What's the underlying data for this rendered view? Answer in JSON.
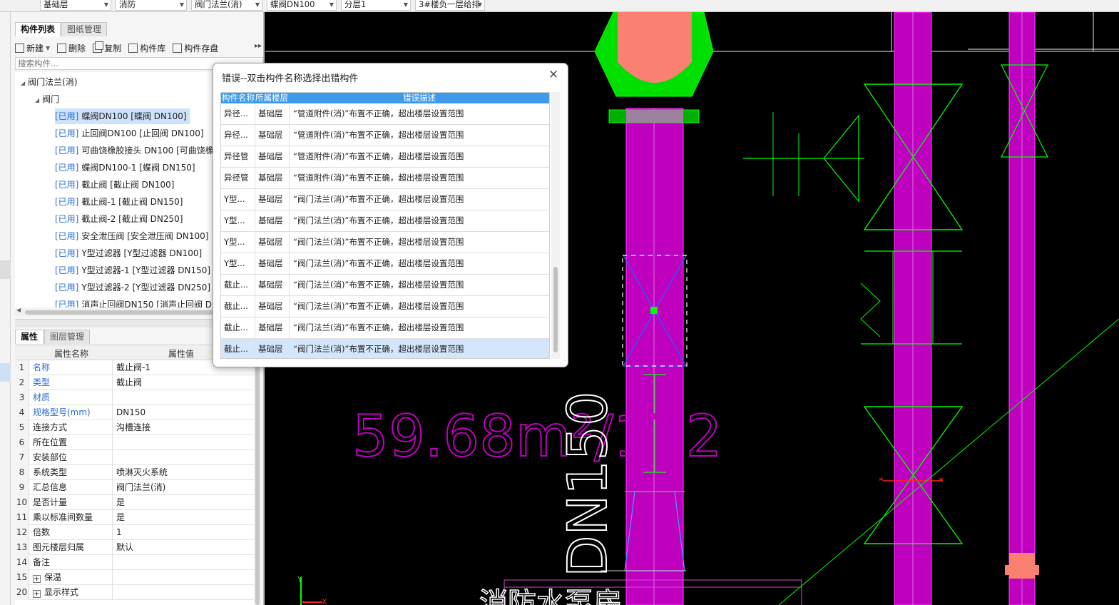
{
  "top_dropdowns": [
    {
      "value": "基础层"
    },
    {
      "value": "消防"
    },
    {
      "value": "阀门法兰(消)"
    },
    {
      "value": "蝶阀DN100"
    },
    {
      "value": "分层1"
    },
    {
      "value": "3#楼负一层给排"
    }
  ],
  "component_panel": {
    "tabs": [
      "构件列表",
      "图纸管理"
    ],
    "toolbar": {
      "new": "新建",
      "delete": "删除",
      "copy": "复制",
      "library": "构件库",
      "save": "构件存盘"
    },
    "search_placeholder": "搜索构件...",
    "tree_root": "阀门法兰(消)",
    "tree_group": "阀门",
    "used_tag": "[已用]",
    "items": [
      "蝶阀DN100 [蝶阀 DN100]",
      "止回阀DN100 [止回阀 DN100]",
      "可曲饶橡胶接头 DN100 [可曲饶橡",
      "蝶阀DN100-1 [蝶阀 DN150]",
      "截止阀 [截止阀 DN100]",
      "截止阀-1 [截止阀 DN150]",
      "截止阀-2 [截止阀 DN250]",
      "安全泄压阀 [安全泄压阀 DN100]",
      "Y型过滤器 [Y型过滤器 DN100]",
      "Y型过滤器-1 [Y型过滤器 DN150]",
      "Y型过滤器-2 [Y型过滤器 DN250]",
      "消声止回阀DN150 [消声止回阀 D"
    ]
  },
  "property_panel": {
    "tabs": [
      "属性",
      "图层管理"
    ],
    "col_name": "属性名称",
    "col_value": "属性值",
    "rows": [
      {
        "n": "1",
        "k": "名称",
        "v": "截止阀-1",
        "blue": true
      },
      {
        "n": "2",
        "k": "类型",
        "v": "截止阀",
        "blue": true
      },
      {
        "n": "3",
        "k": "材质",
        "v": "",
        "blue": true
      },
      {
        "n": "4",
        "k": "规格型号(mm)",
        "v": "DN150",
        "blue": true
      },
      {
        "n": "5",
        "k": "连接方式",
        "v": "沟槽连接",
        "blue": false
      },
      {
        "n": "6",
        "k": "所在位置",
        "v": "",
        "blue": false
      },
      {
        "n": "7",
        "k": "安装部位",
        "v": "",
        "blue": false
      },
      {
        "n": "8",
        "k": "系统类型",
        "v": "喷淋灭火系统",
        "blue": false
      },
      {
        "n": "9",
        "k": "汇总信息",
        "v": "阀门法兰(消)",
        "blue": false
      },
      {
        "n": "10",
        "k": "是否计量",
        "v": "是",
        "blue": false
      },
      {
        "n": "11",
        "k": "乘以标准间数量",
        "v": "是",
        "blue": false
      },
      {
        "n": "12",
        "k": "倍数",
        "v": "1",
        "blue": false
      },
      {
        "n": "13",
        "k": "图元楼层归属",
        "v": "默认",
        "blue": false
      },
      {
        "n": "14",
        "k": "备注",
        "v": "",
        "blue": false
      },
      {
        "n": "15",
        "k": "保温",
        "v": "",
        "blue": false,
        "expand": true
      },
      {
        "n": "20",
        "k": "显示样式",
        "v": "",
        "blue": false,
        "expand": true
      }
    ]
  },
  "dialog": {
    "title": "错误--双击构件名称选择出错构件",
    "columns": [
      "构件名称",
      "所属楼层",
      "错误描述"
    ],
    "rows": [
      {
        "name": "异径...",
        "floor": "基础层",
        "desc": "“管道附件(消)”布置不正确，超出楼层设置范围"
      },
      {
        "name": "异径...",
        "floor": "基础层",
        "desc": "“管道附件(消)”布置不正确，超出楼层设置范围"
      },
      {
        "name": "异径管",
        "floor": "基础层",
        "desc": "“管道附件(消)”布置不正确，超出楼层设置范围"
      },
      {
        "name": "异径管",
        "floor": "基础层",
        "desc": "“管道附件(消)”布置不正确，超出楼层设置范围"
      },
      {
        "name": "Y型...",
        "floor": "基础层",
        "desc": "“阀门法兰(消)”布置不正确，超出楼层设置范围"
      },
      {
        "name": "Y型...",
        "floor": "基础层",
        "desc": "“阀门法兰(消)”布置不正确，超出楼层设置范围"
      },
      {
        "name": "Y型...",
        "floor": "基础层",
        "desc": "“阀门法兰(消)”布置不正确，超出楼层设置范围"
      },
      {
        "name": "Y型...",
        "floor": "基础层",
        "desc": "“阀门法兰(消)”布置不正确，超出楼层设置范围"
      },
      {
        "name": "截止...",
        "floor": "基础层",
        "desc": "“阀门法兰(消)”布置不正确，超出楼层设置范围"
      },
      {
        "name": "截止...",
        "floor": "基础层",
        "desc": "“阀门法兰(消)”布置不正确，超出楼层设置范围"
      },
      {
        "name": "截止...",
        "floor": "基础层",
        "desc": "“阀门法兰(消)”布置不正确，超出楼层设置范围"
      },
      {
        "name": "截止...",
        "floor": "基础层",
        "desc": "“阀门法兰(消)”布置不正确，超出楼层设置范围"
      }
    ],
    "selected_row": 11
  },
  "cad": {
    "area_text": "59.68m²/172",
    "pipe_label": "DN150",
    "bottom_text": "消防水泵房",
    "colors": {
      "pipe": "#bf00bf",
      "pipe_edge": "#ff40ff",
      "valve": "#00ff00",
      "flange": "#fa8072",
      "text": "#c000c0",
      "selection": "#2a5cff"
    }
  }
}
